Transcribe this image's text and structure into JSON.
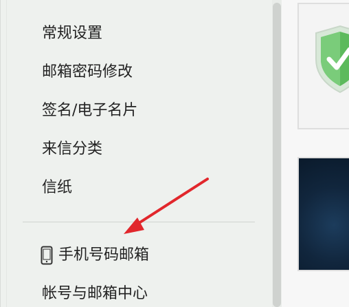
{
  "menu": {
    "items": [
      {
        "label": "常规设置"
      },
      {
        "label": "邮箱密码修改"
      },
      {
        "label": "签名/电子名片"
      },
      {
        "label": "来信分类"
      },
      {
        "label": "信纸"
      }
    ],
    "phone_mailbox": {
      "label": "手机号码邮箱",
      "icon": "mobile-phone-icon"
    },
    "account_center": {
      "label": "帐号与邮箱中心"
    }
  },
  "annotation": {
    "color": "#e1272c",
    "type": "arrow"
  },
  "thumbnails": [
    {
      "icon": "green-shield-icon",
      "accent": "#4caf50"
    },
    {
      "background": "#11263d"
    }
  ]
}
